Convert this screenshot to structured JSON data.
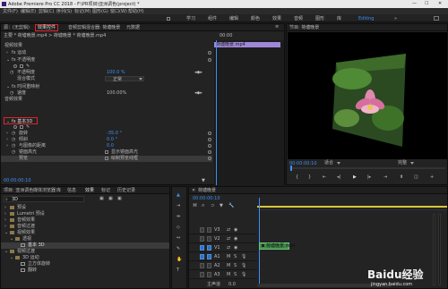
{
  "window": {
    "title": "Adobe Premiere Pro CC 2018 - F:\\PR项目\\亚洲调色(project) *"
  },
  "menu": [
    "文件(F)",
    "编辑(E)",
    "剪辑(C)",
    "序列(S)",
    "标记(M)",
    "图形(G)",
    "窗口(W)",
    "帮助(H)"
  ],
  "workspaces": [
    "学习",
    "组件",
    "编辑",
    "颜色",
    "效果",
    "音频",
    "图形",
    "库",
    "Editing"
  ],
  "source_panel": {
    "tabs": [
      "源：(无剪辑)",
      "效果控件",
      "音频剪辑混合器: 荷塘晚景",
      "元数据"
    ],
    "active_tab": "效果控件",
    "breadcrumb": "主要 * 荷塘晚景.mp4 > 荷塘晚景 * 荷塘晚景.mp4",
    "ruler_time": "00:00",
    "clip_label": "荷塘晚景.mp4",
    "sections": [
      "视频效果",
      "fx 运动",
      "fx 不透明度",
      "不透明度",
      "混合模式",
      "fx 时间重映射",
      "速度",
      "音频效果",
      "fx 基本3D"
    ],
    "values": {
      "opacity": "100.0 %",
      "blend": "正常",
      "speed": "100.00%"
    },
    "basic3d": [
      {
        "name": "旋转",
        "value": "-35.0 °"
      },
      {
        "name": "倾斜",
        "value": "0.0 °"
      },
      {
        "name": "与图像的距离",
        "value": "0.0"
      },
      {
        "name": "镜面高光",
        "value": "显示镜面高光"
      },
      {
        "name": "预览",
        "value": "绘制预览线框"
      }
    ],
    "timecode": "00:00:00:10"
  },
  "program_panel": {
    "tab": "节目: 荷塘晚景",
    "timecode": "00:00:00:10",
    "fit": "适合",
    "quality": "完整"
  },
  "project_panel": {
    "tabs": [
      "项目: 亚洲调色",
      "媒体浏览器",
      "库",
      "信息",
      "效果",
      "标记",
      "历史记录"
    ],
    "active_tab": "效果",
    "search": "3D",
    "tree": [
      "预设",
      "Lumetri 预设",
      "音频效果",
      "音频过渡",
      "视频效果",
      "透视",
      "基本 3D",
      "视频过渡",
      "3D 运动",
      "立方体旋转",
      "翻转"
    ],
    "selected": "基本 3D"
  },
  "timeline_panel": {
    "tab": "荷塘晚景",
    "timecode": "00:00:00:10",
    "tracks": [
      "V3",
      "V2",
      "V1",
      "A1",
      "A2",
      "A3"
    ],
    "master": "主声道",
    "master_value": "0.0",
    "clip_label": "荷塘晚景.mp4"
  },
  "watermark": {
    "brand": "Baidu经验",
    "url": "jingyan.baidu.com"
  }
}
